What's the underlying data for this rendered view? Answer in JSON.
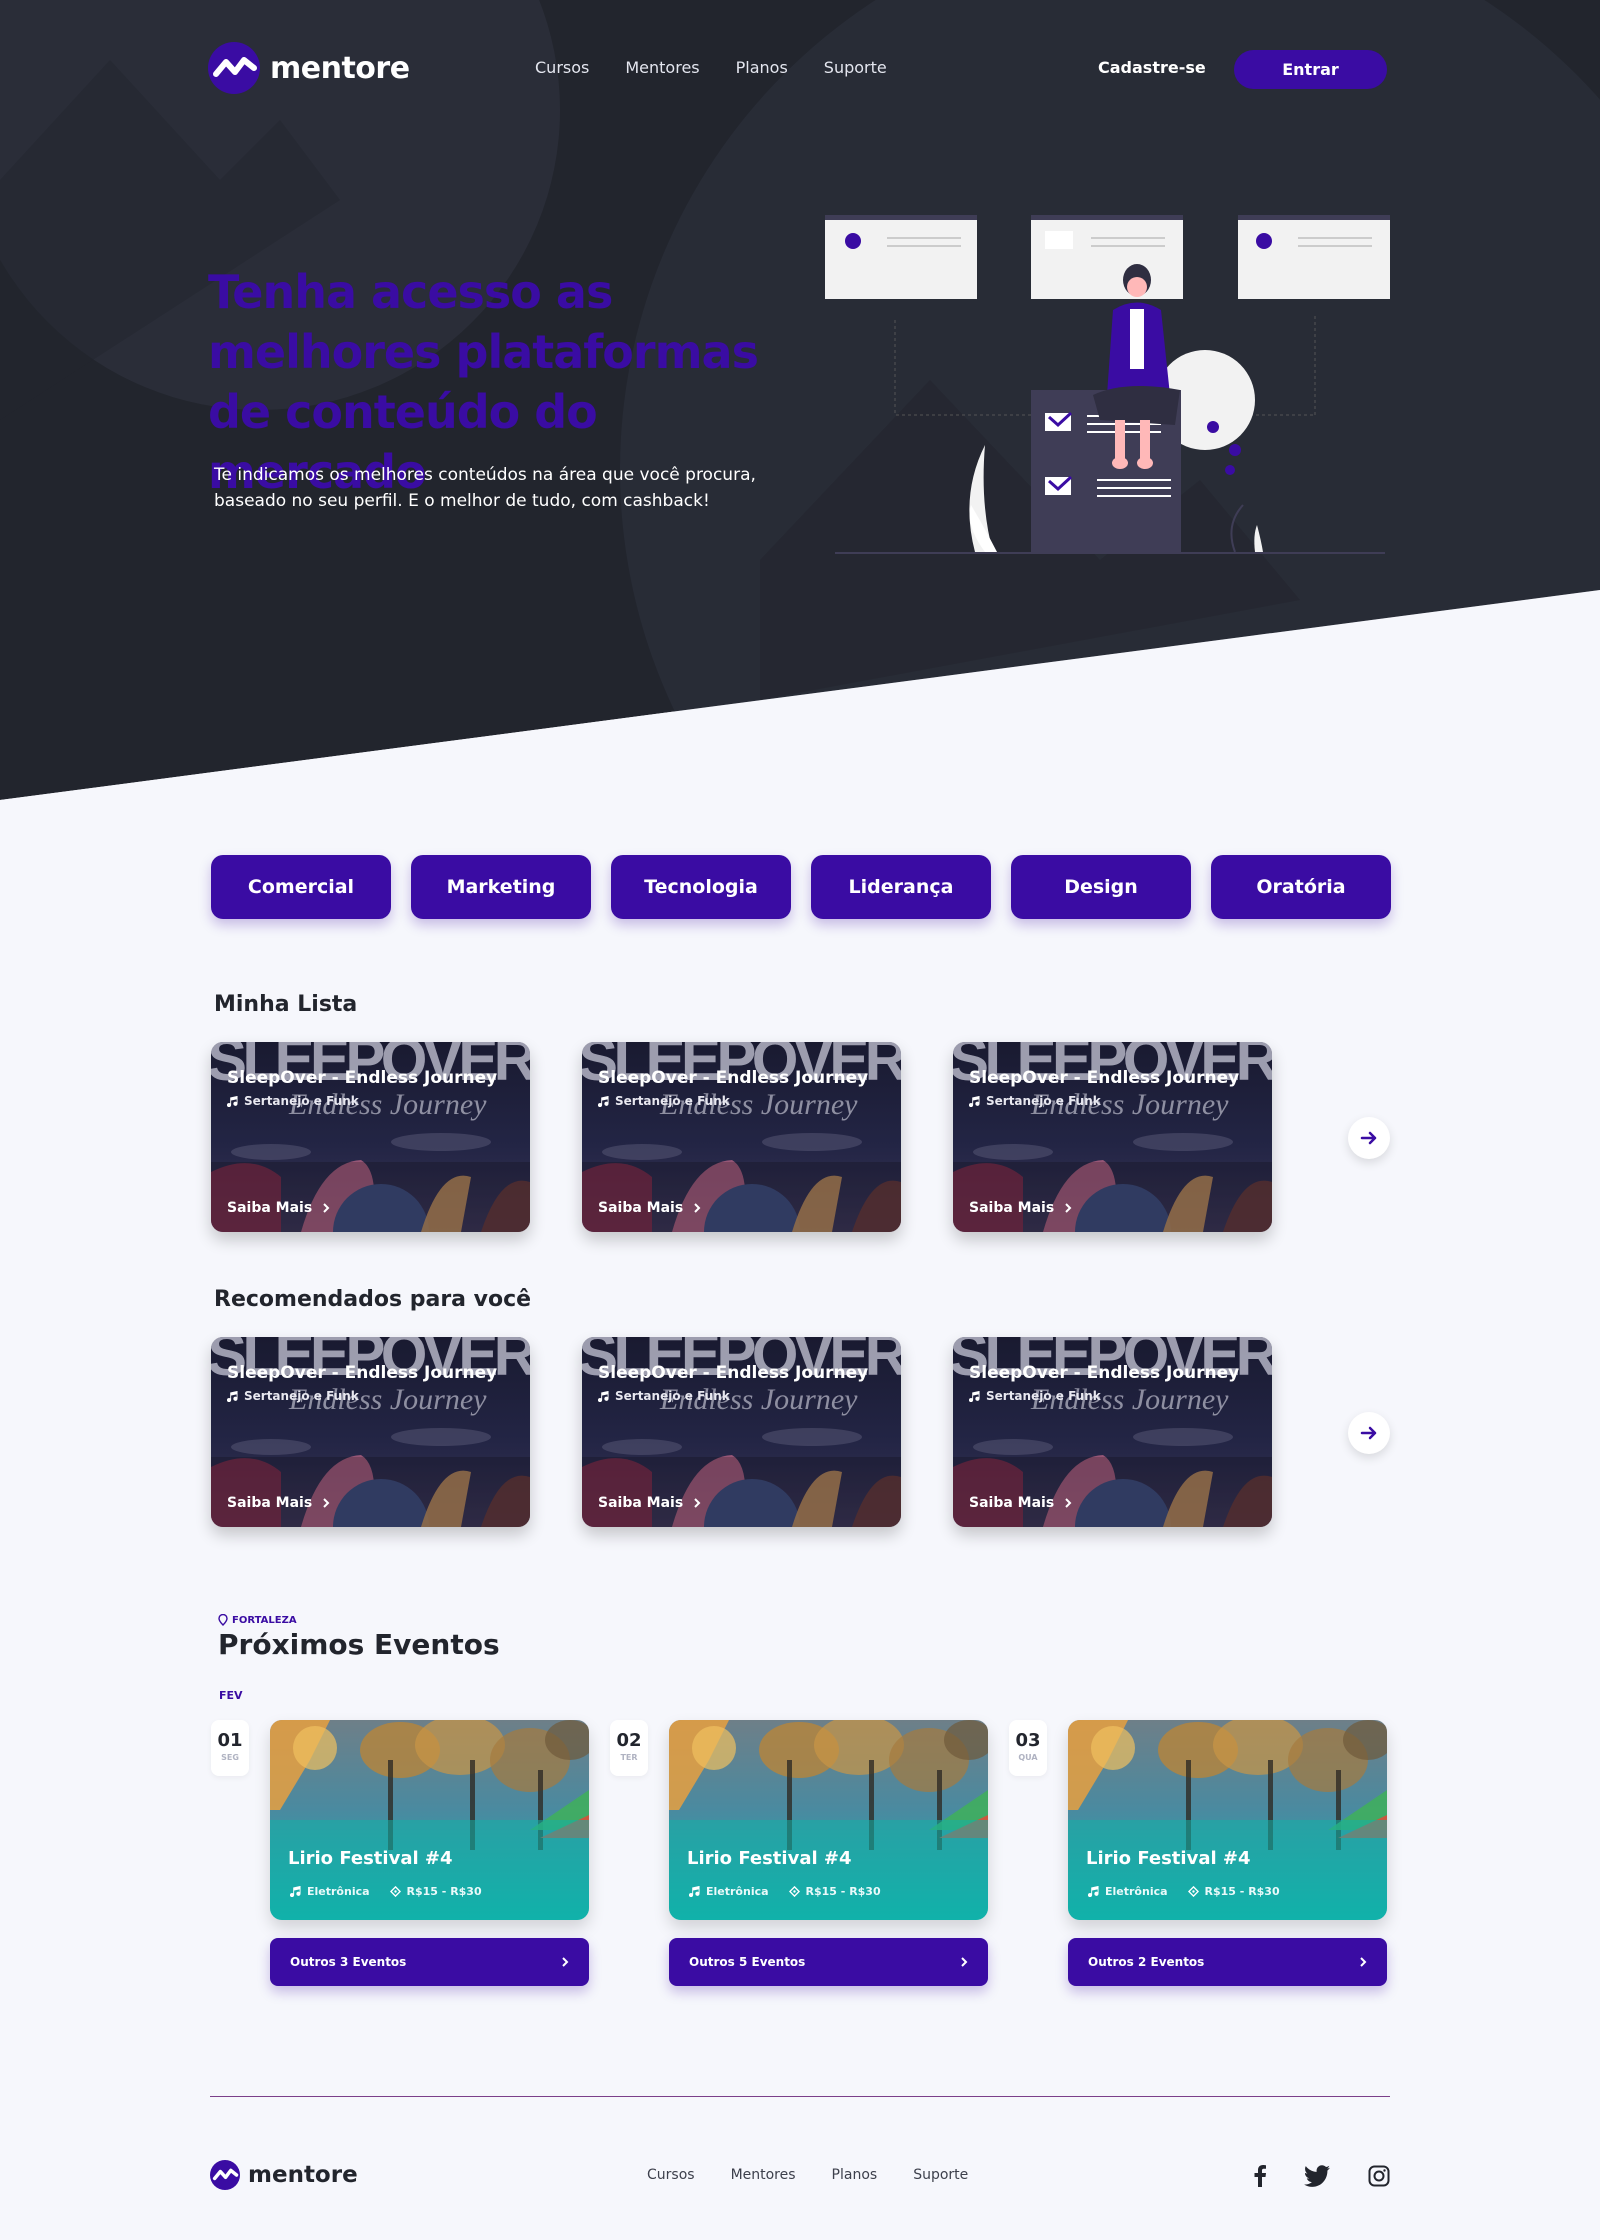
{
  "brand": {
    "name": "mentore",
    "accent": "#3a0ca3",
    "hero_bg": "#22252d"
  },
  "nav": {
    "links": [
      "Cursos",
      "Mentores",
      "Planos",
      "Suporte"
    ],
    "signup": "Cadastre-se",
    "login": "Entrar"
  },
  "hero": {
    "title": "Tenha acesso as melhores plataformas de conteúdo do mercado",
    "subtitle": "Te indicamos os melhores conteúdos na área que você procura, baseado no seu perfil. E o melhor de tudo, com cashback!"
  },
  "categories": [
    "Comercial",
    "Marketing",
    "Tecnologia",
    "Liderança",
    "Design",
    "Oratória"
  ],
  "my_list": {
    "title": "Minha Lista",
    "items": [
      {
        "title": "SleepOver - Endless Journey",
        "genre": "Sertanejo e Funk",
        "more": "Saiba Mais"
      },
      {
        "title": "SleepOver - Endless Journey",
        "genre": "Sertanejo e Funk",
        "more": "Saiba Mais"
      },
      {
        "title": "SleepOver - Endless Journey",
        "genre": "Sertanejo e Funk",
        "more": "Saiba Mais"
      }
    ]
  },
  "recommended": {
    "title": "Recomendados para você",
    "items": [
      {
        "title": "SleepOver - Endless Journey",
        "genre": "Sertanejo e Funk",
        "more": "Saiba Mais"
      },
      {
        "title": "SleepOver - Endless Journey",
        "genre": "Sertanejo e Funk",
        "more": "Saiba Mais"
      },
      {
        "title": "SleepOver - Endless Journey",
        "genre": "Sertanejo e Funk",
        "more": "Saiba Mais"
      }
    ]
  },
  "cover_art_text": {
    "big": "SLEEPOVER",
    "script": "Endless Journey"
  },
  "events": {
    "city": "FORTALEZA",
    "title": "Próximos Eventos",
    "month": "FEV",
    "items": [
      {
        "day": "01",
        "weekday": "SEG",
        "title": "Lirio Festival #4",
        "genre": "Eletrônica",
        "price": "R$15 - R$30",
        "more": "Outros 3 Eventos"
      },
      {
        "day": "02",
        "weekday": "TER",
        "title": "Lirio Festival #4",
        "genre": "Eletrônica",
        "price": "R$15 - R$30",
        "more": "Outros 5 Eventos"
      },
      {
        "day": "03",
        "weekday": "QUA",
        "title": "Lirio Festival #4",
        "genre": "Eletrônica",
        "price": "R$15 - R$30",
        "more": "Outros 2 Eventos"
      }
    ]
  },
  "footer": {
    "links": [
      "Cursos",
      "Mentores",
      "Planos",
      "Suporte"
    ],
    "social": [
      "facebook-icon",
      "twitter-icon",
      "instagram-icon"
    ]
  }
}
